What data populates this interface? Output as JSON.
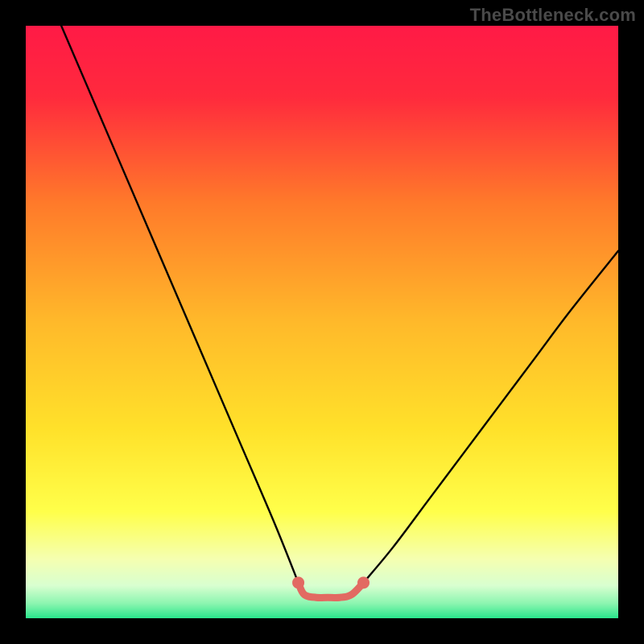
{
  "watermark": "TheBottleneck.com",
  "chart_data": {
    "type": "line",
    "title": "",
    "xlabel": "",
    "ylabel": "",
    "xlim": [
      0,
      100
    ],
    "ylim": [
      0,
      100
    ],
    "grid": false,
    "legend": false,
    "background_gradient": {
      "stops": [
        {
          "offset": 0.0,
          "color": "#ff1a46"
        },
        {
          "offset": 0.12,
          "color": "#ff2a3d"
        },
        {
          "offset": 0.3,
          "color": "#ff7a2a"
        },
        {
          "offset": 0.5,
          "color": "#ffb92a"
        },
        {
          "offset": 0.68,
          "color": "#ffe12a"
        },
        {
          "offset": 0.82,
          "color": "#ffff4a"
        },
        {
          "offset": 0.9,
          "color": "#f5ffb0"
        },
        {
          "offset": 0.945,
          "color": "#d8ffd0"
        },
        {
          "offset": 0.975,
          "color": "#8cf5b0"
        },
        {
          "offset": 1.0,
          "color": "#29e68c"
        }
      ]
    },
    "series": [
      {
        "name": "left-curve",
        "x": [
          6,
          12,
          18,
          24,
          30,
          36,
          42,
          46
        ],
        "y": [
          100,
          86,
          72,
          58,
          44,
          30,
          16,
          6
        ]
      },
      {
        "name": "right-curve",
        "x": [
          57,
          62,
          68,
          74,
          80,
          86,
          92,
          100
        ],
        "y": [
          6,
          12,
          20,
          28,
          36,
          44,
          52,
          62
        ]
      },
      {
        "name": "trough-segment",
        "color": "#e26a62",
        "points": [
          {
            "x": 46,
            "y": 6
          },
          {
            "x": 47,
            "y": 4
          },
          {
            "x": 49,
            "y": 3.5
          },
          {
            "x": 51,
            "y": 3.5
          },
          {
            "x": 53,
            "y": 3.5
          },
          {
            "x": 55,
            "y": 4
          },
          {
            "x": 57,
            "y": 6
          }
        ],
        "endpoint_markers": true
      }
    ]
  }
}
